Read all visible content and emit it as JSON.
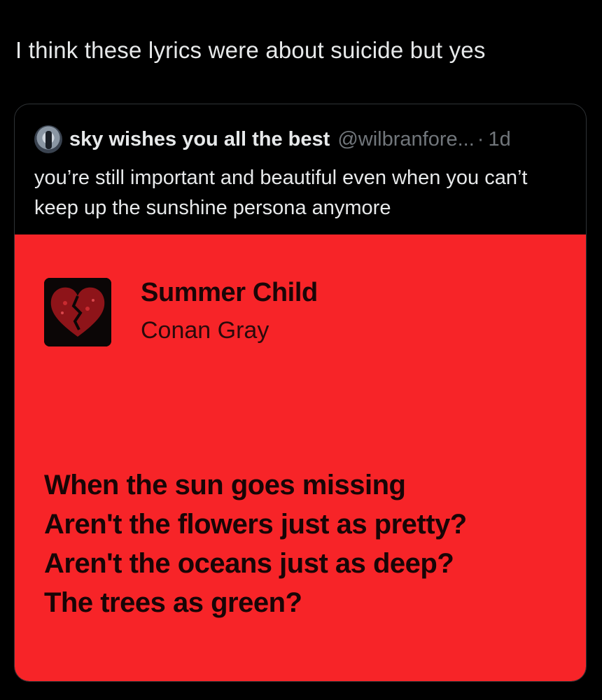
{
  "post": {
    "text": "I think these lyrics were about suicide but yes"
  },
  "quoted_post": {
    "display_name": "sky wishes you all the best",
    "handle": "@wilbranfore...",
    "separator": "·",
    "age": "1d",
    "text": "you’re still important and beautiful even when you can’t keep up the sunshine persona anymore",
    "avatar_icon": "profile-avatar"
  },
  "lyrics_card": {
    "background_color": "#f72428",
    "album_icon": "broken-heart-album-art",
    "song_title": "Summer Child",
    "artist": "Conan Gray",
    "lines": [
      "When the sun goes missing",
      "Aren't the flowers just as pretty?",
      "Aren't the oceans just as deep?",
      "The trees as green?"
    ]
  }
}
